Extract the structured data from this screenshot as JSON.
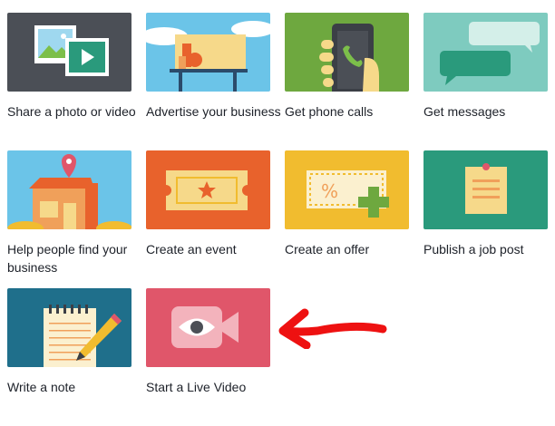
{
  "tiles": [
    {
      "id": "share-photo",
      "label": "Share a photo or video",
      "color": "#4b4f56"
    },
    {
      "id": "advertise",
      "label": "Advertise your business",
      "color": "#6bc4e8"
    },
    {
      "id": "phone-calls",
      "label": "Get phone calls",
      "color": "#6ea83f"
    },
    {
      "id": "messages",
      "label": "Get messages",
      "color": "#7ecbbf"
    },
    {
      "id": "find-business",
      "label": "Help people find your business",
      "color": "#6bc4e8"
    },
    {
      "id": "event",
      "label": "Create an event",
      "color": "#e8622c"
    },
    {
      "id": "offer",
      "label": "Create an offer",
      "color": "#f1bc2f"
    },
    {
      "id": "job-post",
      "label": "Publish a job post",
      "color": "#2a9a7c"
    },
    {
      "id": "note",
      "label": "Write a note",
      "color": "#1f6f8b"
    },
    {
      "id": "live-video",
      "label": "Start a Live Video",
      "color": "#e0566a"
    }
  ],
  "annotation": {
    "color": "#ee1111",
    "icon": "red-arrow-annotation"
  }
}
